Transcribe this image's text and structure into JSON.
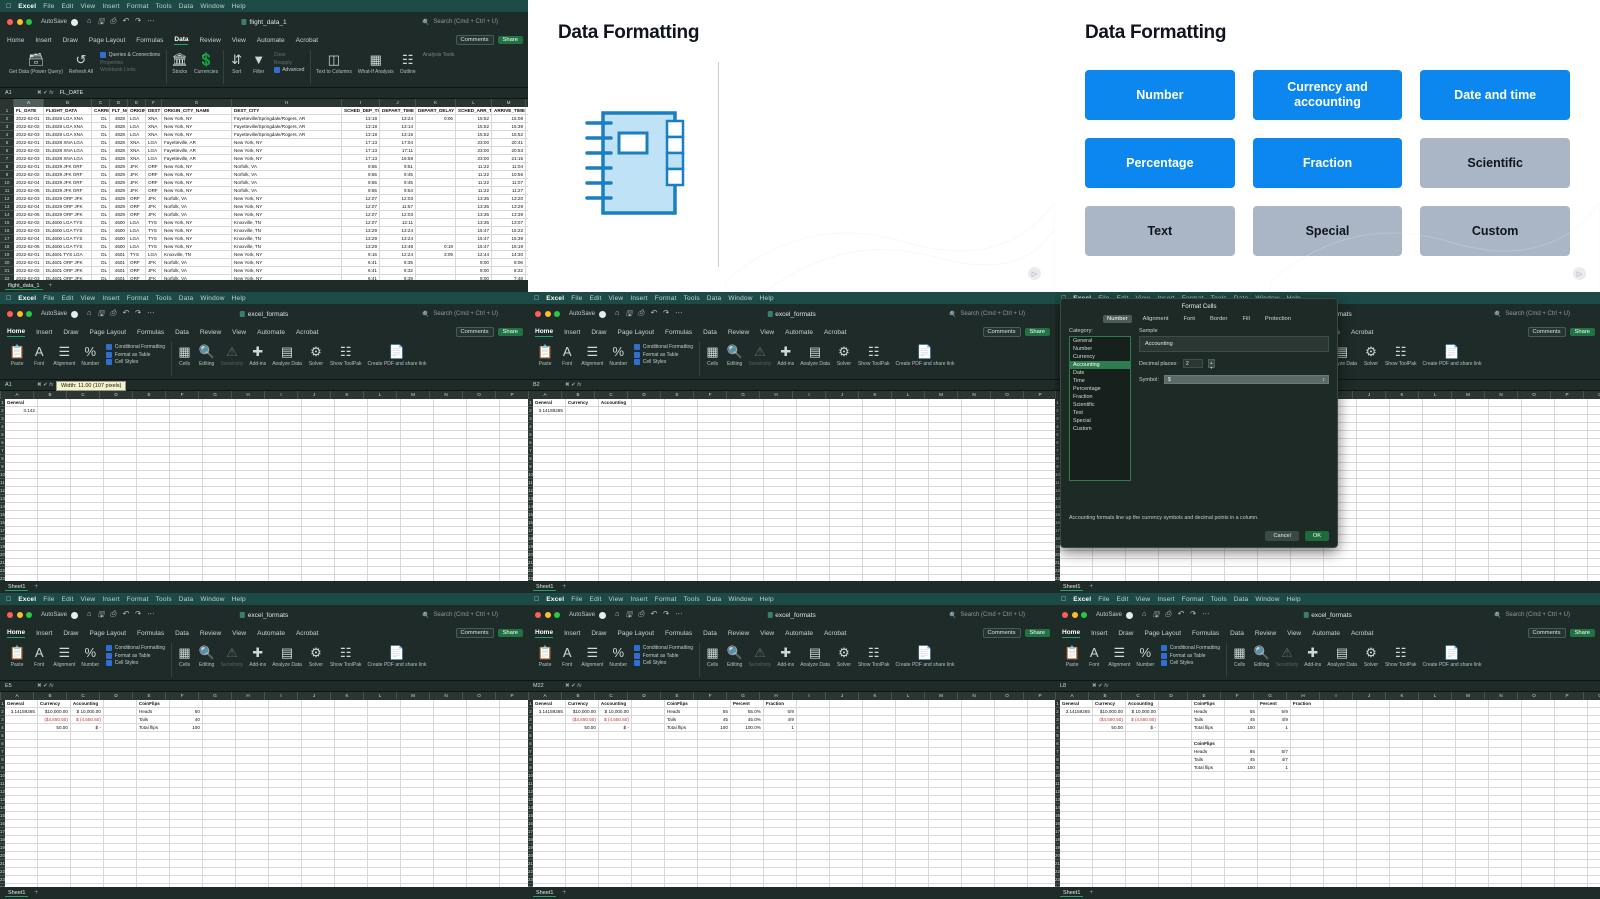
{
  "app": {
    "name": "Excel",
    "menus": [
      "Excel",
      "File",
      "Edit",
      "View",
      "Insert",
      "Format",
      "Tools",
      "Data",
      "Window",
      "Help"
    ],
    "autosave_label": "AutoSave",
    "search_placeholder": "Search (Cmd + Ctrl + U)",
    "comments_label": "Comments",
    "share_label": "Share",
    "ribbon_tabs_data": [
      "Home",
      "Insert",
      "Draw",
      "Page Layout",
      "Formulas",
      "Data",
      "Review",
      "View",
      "Automate",
      "Acrobat"
    ],
    "ribbon_tabs_home": [
      "Home",
      "Insert",
      "Draw",
      "Page Layout",
      "Formulas",
      "Data",
      "Review",
      "View",
      "Automate",
      "Acrobat"
    ]
  },
  "panels": {
    "flight": {
      "title": "flight_data_1",
      "active_tab": "Data",
      "namebox": "A1",
      "formula": "FL_DATE",
      "sheet_tab": "flight_data_1",
      "ribbon_groups": [
        {
          "icon": "database-icon",
          "label": "Get Data (Power Query)"
        },
        {
          "icon": "refresh-icon",
          "label": "Refresh All"
        },
        {
          "icon": "stocks-icon",
          "label": "Stocks"
        },
        {
          "icon": "currencies-icon",
          "label": "Currencies"
        },
        {
          "icon": "sort-icon",
          "label": "Sort"
        },
        {
          "icon": "filter-icon",
          "label": "Filter"
        },
        {
          "icon": "text-to-columns-icon",
          "label": "Text to Columns"
        },
        {
          "icon": "what-if-icon",
          "label": "What-If Analysis"
        },
        {
          "icon": "outline-icon",
          "label": "Outline"
        }
      ],
      "ribbon_stack": [
        "Queries & Connections",
        "Properties",
        "Workbook Links"
      ],
      "ribbon_stack2": [
        "Clear",
        "Reapply",
        "Advanced"
      ],
      "analysis_tools": "Analysis Tools",
      "columns": [
        "A",
        "B",
        "C",
        "D",
        "E",
        "F",
        "G",
        "H",
        "I",
        "J",
        "K",
        "L",
        "M"
      ],
      "headers": [
        "FL_DATE",
        "FLIGHT_DATA",
        "CARRIER",
        "FLT_NO",
        "ORIGIN",
        "DEST",
        "ORIGIN_CITY_NAME",
        "DEST_CITY",
        "SCHED_DEP_TIME",
        "DEPART_TIME",
        "DEPART_DELAY",
        "SCHED_ARR_TIME",
        "ARRIVE_TIME"
      ],
      "rows": [
        [
          "2022-02-01",
          "DL4828 LGA XNA",
          "DL",
          "4828",
          "LGA",
          "XNA",
          "New York, NY",
          "Fayetteville/Springdale/Rogers, AR",
          "13:18",
          "13:24",
          "0:06",
          "15:52",
          "15:08"
        ],
        [
          "2022-02-02",
          "DL4828 LGA XNA",
          "DL",
          "4828",
          "LGA",
          "XNA",
          "New York, NY",
          "Fayetteville/Springdale/Rogers, AR",
          "13:18",
          "13:14",
          "",
          "15:52",
          "15:39"
        ],
        [
          "2022-02-03",
          "DL4828 LGA XNA",
          "DL",
          "4828",
          "LGA",
          "XNA",
          "New York, NY",
          "Fayetteville/Springdale/Rogers, AR",
          "13:18",
          "13:15",
          "",
          "15:52",
          "15:52"
        ],
        [
          "2022-02-01",
          "DL4828 XNA LGA",
          "DL",
          "4828",
          "XNA",
          "LGA",
          "Fayetteville, AR",
          "New York, NY",
          "17:13",
          "17:04",
          "",
          "23:00",
          "20:41"
        ],
        [
          "2022-02-02",
          "DL4828 XNA LGA",
          "DL",
          "4828",
          "XNA",
          "LGA",
          "Fayetteville, AR",
          "New York, NY",
          "17:13",
          "17:11",
          "",
          "23:00",
          "20:53"
        ],
        [
          "2022-02-03",
          "DL4828 XNA LGA",
          "DL",
          "4828",
          "XNA",
          "LGA",
          "Fayetteville, AR",
          "New York, NY",
          "17:13",
          "16:59",
          "",
          "23:00",
          "21:15"
        ],
        [
          "2022-02-01",
          "DL4829 JFK ORF",
          "DL",
          "4829",
          "JFK",
          "ORF",
          "New York, NY",
          "Norfolk, VA",
          "9:55",
          "9:51",
          "",
          "11:22",
          "11:04"
        ],
        [
          "2022-02-02",
          "DL4829 JFK ORF",
          "DL",
          "4829",
          "JFK",
          "ORF",
          "New York, NY",
          "Norfolk, VA",
          "9:55",
          "9:45",
          "",
          "11:22",
          "10:56"
        ],
        [
          "2022-02-04",
          "DL4829 JFK ORF",
          "DL",
          "4829",
          "JFK",
          "ORF",
          "New York, NY",
          "Norfolk, VA",
          "9:55",
          "9:45",
          "",
          "11:22",
          "11:07"
        ],
        [
          "2022-02-05",
          "DL4829 JFK ORF",
          "DL",
          "4829",
          "JFK",
          "ORF",
          "New York, NY",
          "Norfolk, VA",
          "9:55",
          "9:54",
          "",
          "11:22",
          "11:27"
        ],
        [
          "2022-02-03",
          "DL4829 ORF JFK",
          "DL",
          "4829",
          "ORF",
          "JFK",
          "Norfolk, VA",
          "New York, NY",
          "12:07",
          "12:03",
          "",
          "13:36",
          "13:20"
        ],
        [
          "2022-02-04",
          "DL4829 ORF JFK",
          "DL",
          "4829",
          "ORF",
          "JFK",
          "Norfolk, VA",
          "New York, NY",
          "12:07",
          "11:57",
          "",
          "13:36",
          "13:29"
        ],
        [
          "2022-02-05",
          "DL4829 ORF JFK",
          "DL",
          "4829",
          "ORF",
          "JFK",
          "Norfolk, VA",
          "New York, NY",
          "12:07",
          "12:03",
          "",
          "13:36",
          "13:39"
        ],
        [
          "2022-02-02",
          "DL4600 LGA TYS",
          "DL",
          "4600",
          "LGA",
          "TYS",
          "New York, NY",
          "Knoxville, TN",
          "12:07",
          "12:11",
          "",
          "13:36",
          "13:07"
        ],
        [
          "2022-02-03",
          "DL4600 LGA TYS",
          "DL",
          "4600",
          "LGA",
          "TYS",
          "New York, NY",
          "Knoxville, TN",
          "13:29",
          "13:24",
          "",
          "15:47",
          "15:22"
        ],
        [
          "2022-02-04",
          "DL4600 LGA TYS",
          "DL",
          "4600",
          "LGA",
          "TYS",
          "New York, NY",
          "Knoxville, TN",
          "13:29",
          "13:24",
          "",
          "15:47",
          "15:39"
        ],
        [
          "2022-02-05",
          "DL4600 LGA TYS",
          "DL",
          "4600",
          "LGA",
          "TYS",
          "New York, NY",
          "Knoxville, TN",
          "13:29",
          "13:48",
          "0:19",
          "15:47",
          "16:19"
        ],
        [
          "2022-02-01",
          "DL4601 TYS LGA",
          "DL",
          "4601",
          "TYS",
          "LGA",
          "Knoxville, TN",
          "New York, NY",
          "9:15",
          "12:24",
          "3:09",
          "12:44",
          "14:30"
        ],
        [
          "2022-02-01",
          "DL4601 ORF JFK",
          "DL",
          "4601",
          "ORF",
          "JFK",
          "Norfolk, VA",
          "New York, NY",
          "6:41",
          "6:35",
          "",
          "8:00",
          "8:06"
        ],
        [
          "2022-02-02",
          "DL4601 ORF JFK",
          "DL",
          "4601",
          "ORF",
          "JFK",
          "Norfolk, VA",
          "New York, NY",
          "6:41",
          "6:32",
          "",
          "8:00",
          "8:22"
        ],
        [
          "2022-02-03",
          "DL4601 ORF JFK",
          "DL",
          "4601",
          "ORF",
          "JFK",
          "Norfolk, VA",
          "New York, NY",
          "6:41",
          "6:39",
          "",
          "8:00",
          "7:48"
        ],
        [
          "2022-02-04",
          "DL4601 ORF JFK",
          "DL",
          "4601",
          "ORF",
          "JFK",
          "Norfolk, VA",
          "New York, NY",
          "6:41",
          "6:35",
          "",
          "8:00",
          "7:55"
        ],
        [
          "2022-02-02",
          "DL4602 ATL HPN",
          "DL",
          "4602",
          "ATL",
          "HPN",
          "Atlanta, GA",
          "White Plains, NY",
          "16:00",
          "15:48",
          "",
          "18:11",
          "18:07"
        ],
        [
          "2022-02-03",
          "DL4602 ATL HPN",
          "DL",
          "4602",
          "ATL",
          "HPN",
          "Atlanta, GA",
          "White Plains, NY",
          "16:00",
          "15:59",
          "",
          "18:11",
          "18:22"
        ],
        [
          "2022-02-03",
          "DL4602 ATL HPN",
          "DL",
          "4602",
          "ATL",
          "HPN",
          "Atlanta, GA",
          "White Plains, NY",
          "16:00",
          "15:50",
          "",
          "18:11",
          "18:17"
        ]
      ]
    },
    "slide_left": {
      "title": "Data Formatting",
      "icon": "notebook-icon"
    },
    "slide_right": {
      "title": "Data Formatting",
      "buttons": [
        {
          "label": "Number",
          "style": "blue"
        },
        {
          "label": "Currency and accounting",
          "style": "blue"
        },
        {
          "label": "Date and time",
          "style": "blue"
        },
        {
          "label": "Percentage",
          "style": "blue"
        },
        {
          "label": "Fraction",
          "style": "blue"
        },
        {
          "label": "Scientific",
          "style": "grey"
        },
        {
          "label": "Text",
          "style": "grey"
        },
        {
          "label": "Special",
          "style": "grey"
        },
        {
          "label": "Custom",
          "style": "grey"
        }
      ],
      "colors": {
        "blue": "#0d87f0",
        "grey": "#aab6c6"
      }
    },
    "sheet_a": {
      "title": "excel_formats",
      "namebox": "A1",
      "formula": "",
      "tooltip": "Width: 11.00 (107 pixels)",
      "sheet_tab": "Sheet1",
      "headers": [
        "General",
        "",
        ""
      ],
      "rows": [
        [
          "General",
          "",
          ""
        ],
        [
          "3.142",
          "",
          ""
        ]
      ]
    },
    "sheet_b": {
      "title": "excel_formats",
      "namebox": "B2",
      "formula": "",
      "sheet_tab": "Sheet1",
      "rows": [
        [
          "General",
          "Currency",
          "Accounting"
        ],
        [
          "3.14159265",
          "",
          ""
        ]
      ]
    },
    "sheet_c": {
      "title": "excel_formats",
      "namebox": "",
      "formula": "",
      "sheet_tab": "Sheet1",
      "dialog": {
        "title": "Format Cells",
        "tabs": [
          "Number",
          "Alignment",
          "Font",
          "Border",
          "Fill",
          "Protection"
        ],
        "active_tab": "Number",
        "category_label": "Category:",
        "categories": [
          "General",
          "Number",
          "Currency",
          "Accounting",
          "Date",
          "Time",
          "Percentage",
          "Fraction",
          "Scientific",
          "Text",
          "Special",
          "Custom"
        ],
        "selected_category": "Accounting",
        "sample_label": "Sample",
        "sample_value": "Accounting",
        "decimal_label": "Decimal places:",
        "decimal_value": "2",
        "symbol_label": "Symbol:",
        "symbol_value": "$",
        "note": "Accounting formats line up the currency symbols and decimal points in a column.",
        "cancel_label": "Cancel",
        "ok_label": "OK"
      }
    },
    "sheet_d": {
      "title": "excel_formats",
      "namebox": "E5",
      "formula": "",
      "sheet_tab": "Sheet1",
      "table": {
        "headers": [
          "General",
          "Currency",
          "Accounting",
          "",
          "CoinFlips",
          ""
        ],
        "rows": [
          [
            "3.14159265",
            "$10,000.00",
            "$ 10,000.00",
            "",
            "Heads",
            "50"
          ],
          [
            "",
            "($4,550.50)",
            "$ (4,550.50)",
            "",
            "Tails",
            "40"
          ],
          [
            "",
            "50.00",
            "$          -",
            "",
            "Total flips",
            "100"
          ]
        ]
      }
    },
    "sheet_e": {
      "title": "excel_formats",
      "namebox": "M22",
      "formula": "",
      "sheet_tab": "Sheet1",
      "table": {
        "headers": [
          "General",
          "Currency",
          "Accounting",
          "",
          "CoinFlips",
          "",
          "Percent",
          "Fraction"
        ],
        "rows": [
          [
            "3.14159265",
            "$10,000.00",
            "$ 10,000.00",
            "",
            "Heads",
            "55",
            "55.0%",
            "5/9"
          ],
          [
            "",
            "($4,550.50)",
            "$ (4,550.50)",
            "",
            "Tails",
            "45",
            "45.0%",
            "4/9"
          ],
          [
            "",
            "50.00",
            "$          -",
            "",
            "Total flips",
            "100",
            "100.0%",
            "1"
          ]
        ]
      }
    },
    "sheet_f": {
      "title": "excel_formats",
      "namebox": "L8",
      "formula": "",
      "sheet_tab": "Sheet1",
      "table": {
        "headers": [
          "General",
          "Currency",
          "Accounting",
          "",
          "CoinFlips",
          "",
          "Percent",
          "Fraction"
        ],
        "rows": [
          [
            "3.14159265",
            "$10,000.00",
            "$ 10,000.00",
            "",
            "Heads",
            "55",
            "5/9",
            ""
          ],
          [
            "",
            "($4,550.50)",
            "$ (4,550.50)",
            "",
            "Tails",
            "45",
            "4/9",
            ""
          ],
          [
            "",
            "50.00",
            "$          -",
            "",
            "Total flips",
            "100",
            "1",
            ""
          ]
        ],
        "second_block_label": "CoinFlips",
        "second_rows": [
          [
            "Heads",
            "85",
            "5/7"
          ],
          [
            "Tails",
            "45",
            "4/7"
          ],
          [
            "Total flips",
            "100",
            "1"
          ]
        ]
      }
    }
  },
  "ribbon_home_groups": [
    {
      "icon": "paste-icon",
      "label": "Paste"
    },
    {
      "icon": "font-icon",
      "label": "Font"
    },
    {
      "icon": "alignment-icon",
      "label": "Alignment"
    },
    {
      "icon": "number-icon",
      "label": "Number"
    },
    {
      "icon": "cells-icon",
      "label": "Cells"
    },
    {
      "icon": "editing-icon",
      "label": "Editing"
    },
    {
      "icon": "sensitivity-icon",
      "label": "Sensitivity"
    },
    {
      "icon": "addins-icon",
      "label": "Add-ins"
    },
    {
      "icon": "analyze-data-icon",
      "label": "Analyze Data"
    },
    {
      "icon": "solver-icon",
      "label": "Solver"
    },
    {
      "icon": "toolpak-icon",
      "label": "Show ToolPak"
    },
    {
      "icon": "pdf-icon",
      "label": "Create PDF and share link"
    }
  ],
  "ribbon_home_stack": [
    "Conditional Formatting",
    "Format as Table",
    "Cell Styles"
  ]
}
